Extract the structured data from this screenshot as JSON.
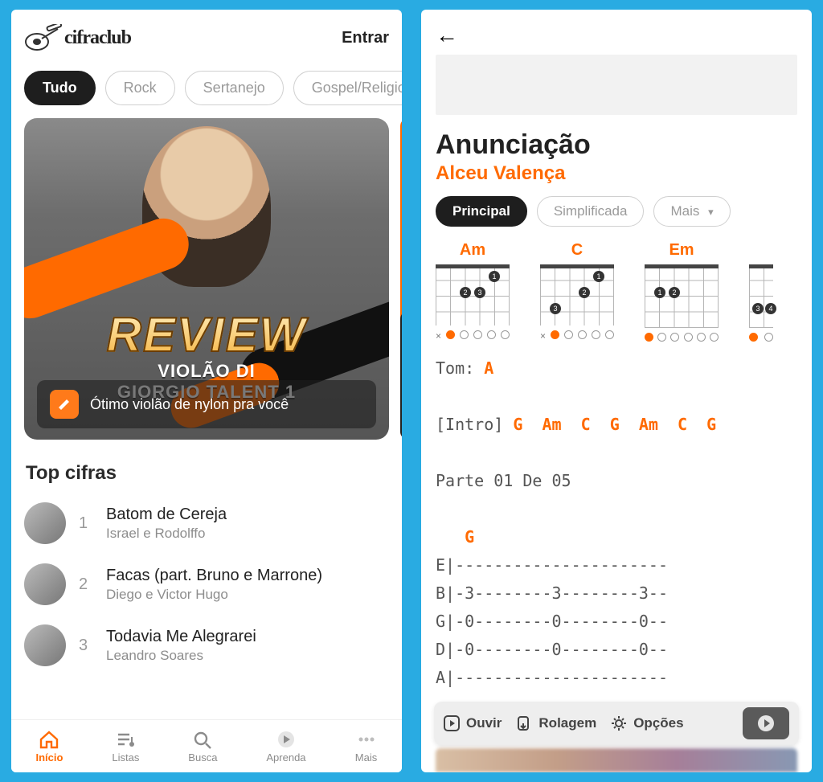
{
  "left": {
    "logo_text": "cifraclub",
    "login": "Entrar",
    "chips": [
      "Tudo",
      "Rock",
      "Sertanejo",
      "Gospel/Religioso"
    ],
    "hero": {
      "review": "REVIEW",
      "sub1": "VIOLÃO DI",
      "sub2": "GIORGIO TALENT 1",
      "caption": "Ótimo violão de nylon pra você"
    },
    "section": "Top cifras",
    "items": [
      {
        "rank": "1",
        "title": "Batom de Cereja",
        "sub": "Israel e Rodolffo"
      },
      {
        "rank": "2",
        "title": "Facas (part. Bruno e Marrone)",
        "sub": "Diego e Victor Hugo"
      },
      {
        "rank": "3",
        "title": "Todavia Me Alegrarei",
        "sub": "Leandro Soares"
      }
    ],
    "nav": [
      "Início",
      "Listas",
      "Busca",
      "Aprenda",
      "Mais"
    ]
  },
  "right": {
    "title": "Anunciação",
    "artist": "Alceu Valença",
    "tabs": {
      "main": "Principal",
      "simple": "Simplificada",
      "more": "Mais"
    },
    "chords": [
      "Am",
      "C",
      "Em"
    ],
    "key_label": "Tom:",
    "key": "A",
    "intro_label": "[Intro]",
    "intro_chords": "G  Am  C  G  Am  C  G",
    "part": "Parte 01 De 05",
    "tab_chord": "G",
    "tab_lines": [
      "E|----------------------",
      "B|-3--------3--------3--",
      "G|-0--------0--------0--",
      "D|-0--------0--------0--",
      "A|----------------------"
    ],
    "actions": {
      "listen": "Ouvir",
      "scroll": "Rolagem",
      "options": "Opções"
    }
  }
}
